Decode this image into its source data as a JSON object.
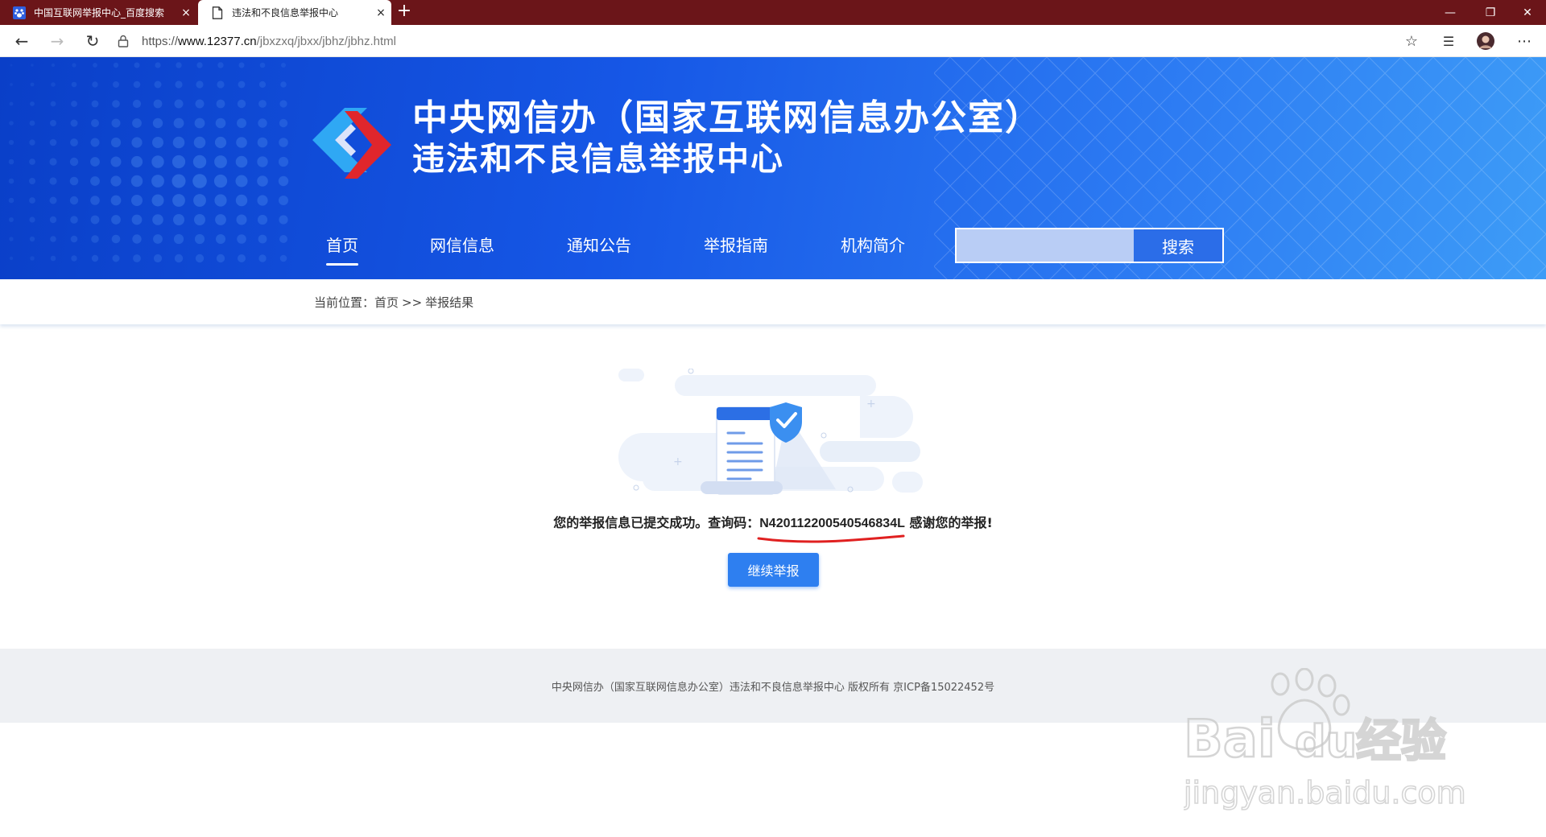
{
  "browser": {
    "tabs": [
      {
        "title": "中国互联网举报中心_百度搜索",
        "icon": "baidu-paw-icon",
        "active": false
      },
      {
        "title": "违法和不良信息举报中心",
        "icon": "document-icon",
        "active": true
      }
    ],
    "close_glyph": "×",
    "new_tab_glyph": "+",
    "window_controls": {
      "minimize": "—",
      "restore": "❐",
      "close": "✕"
    },
    "url": {
      "scheme": "https://",
      "host": "www.12377.cn",
      "path": "/jbxzxq/jbxx/jbhz/jbhz.html"
    },
    "nav_glyphs": {
      "back": "←",
      "forward": "→",
      "refresh": "↻",
      "favorite": "☆",
      "favorites_list": "☰",
      "more": "⋯"
    }
  },
  "site": {
    "title": "中央网信办（国家互联网信息办公室）",
    "subtitle": "违法和不良信息举报中心",
    "nav": [
      {
        "label": "首页",
        "active": true
      },
      {
        "label": "网信信息",
        "active": false
      },
      {
        "label": "通知公告",
        "active": false
      },
      {
        "label": "举报指南",
        "active": false
      },
      {
        "label": "机构简介",
        "active": false
      }
    ],
    "search": {
      "placeholder": "",
      "button_label": "搜索"
    },
    "colors": {
      "header_start": "#0a3fc8",
      "header_end": "#3d9cf7",
      "accent": "#2e7ff0",
      "tabbar": "#6b1519"
    }
  },
  "breadcrumb": {
    "prefix": "当前位置：",
    "items": [
      "首页",
      "举报结果"
    ],
    "separator": ">>"
  },
  "result": {
    "message_before": "您的举报信息已提交成功。查询码：",
    "query_code": "N420112200540546834L",
    "message_after": " 感谢您的举报!",
    "continue_button": "继续举报"
  },
  "footer": {
    "text": "中央网信办（国家互联网信息办公室）违法和不良信息举报中心 版权所有 京ICP备15022452号"
  },
  "watermark": {
    "brand": "Bai du 经验",
    "domain": "jingyan.baidu.com"
  }
}
